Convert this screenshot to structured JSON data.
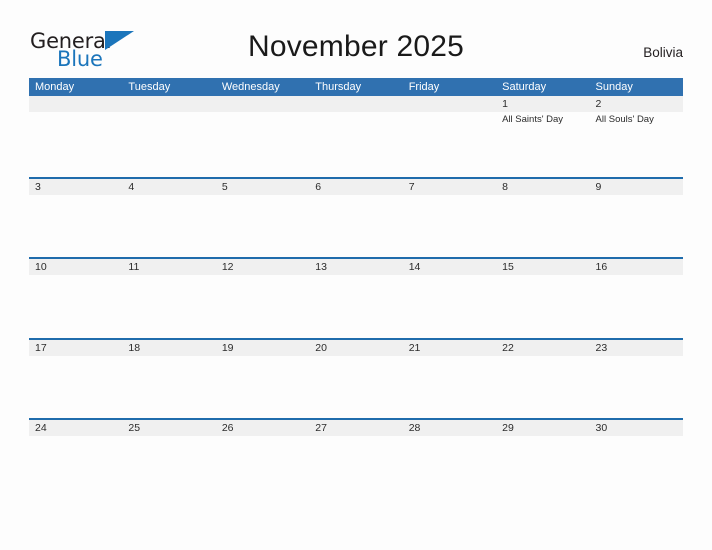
{
  "brand": {
    "name_part1": "General",
    "name_part2": "Blue",
    "flag_icon": "flag-triangle-icon",
    "colors": {
      "dark": "#231f20",
      "blue": "#1b75bb"
    }
  },
  "header": {
    "title": "November 2025",
    "country": "Bolivia"
  },
  "theme": {
    "header_blue": "#3071b0",
    "separator_blue": "#1f6cac",
    "band_gray": "#f0f0f0",
    "text_dark": "#2b2b2b",
    "page_background": "#fdfdfd"
  },
  "calendar": {
    "month": "November",
    "year": "2025",
    "week_start": "Monday",
    "weekdays": [
      "Monday",
      "Tuesday",
      "Wednesday",
      "Thursday",
      "Friday",
      "Saturday",
      "Sunday"
    ],
    "weeks": [
      {
        "days": [
          {
            "num": "",
            "event": ""
          },
          {
            "num": "",
            "event": ""
          },
          {
            "num": "",
            "event": ""
          },
          {
            "num": "",
            "event": ""
          },
          {
            "num": "",
            "event": ""
          },
          {
            "num": "1",
            "event": "All Saints' Day"
          },
          {
            "num": "2",
            "event": "All Souls' Day"
          }
        ]
      },
      {
        "days": [
          {
            "num": "3",
            "event": ""
          },
          {
            "num": "4",
            "event": ""
          },
          {
            "num": "5",
            "event": ""
          },
          {
            "num": "6",
            "event": ""
          },
          {
            "num": "7",
            "event": ""
          },
          {
            "num": "8",
            "event": ""
          },
          {
            "num": "9",
            "event": ""
          }
        ]
      },
      {
        "days": [
          {
            "num": "10",
            "event": ""
          },
          {
            "num": "11",
            "event": ""
          },
          {
            "num": "12",
            "event": ""
          },
          {
            "num": "13",
            "event": ""
          },
          {
            "num": "14",
            "event": ""
          },
          {
            "num": "15",
            "event": ""
          },
          {
            "num": "16",
            "event": ""
          }
        ]
      },
      {
        "days": [
          {
            "num": "17",
            "event": ""
          },
          {
            "num": "18",
            "event": ""
          },
          {
            "num": "19",
            "event": ""
          },
          {
            "num": "20",
            "event": ""
          },
          {
            "num": "21",
            "event": ""
          },
          {
            "num": "22",
            "event": ""
          },
          {
            "num": "23",
            "event": ""
          }
        ]
      },
      {
        "days": [
          {
            "num": "24",
            "event": ""
          },
          {
            "num": "25",
            "event": ""
          },
          {
            "num": "26",
            "event": ""
          },
          {
            "num": "27",
            "event": ""
          },
          {
            "num": "28",
            "event": ""
          },
          {
            "num": "29",
            "event": ""
          },
          {
            "num": "30",
            "event": ""
          }
        ]
      }
    ]
  }
}
